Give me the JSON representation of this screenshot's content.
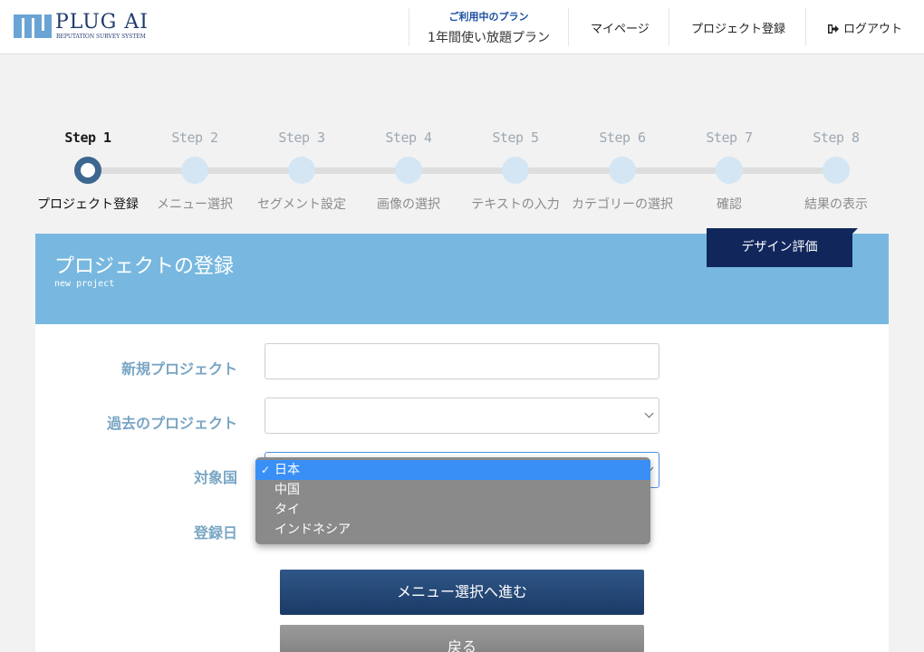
{
  "header": {
    "logo_title": "PLUG AI",
    "logo_subtitle": "REPUTATION SURVEY SYSTEM",
    "plan_label": "ご利用中のプラン",
    "plan_name": "1年間使い放題プラン",
    "nav": {
      "mypage": "マイページ",
      "project_register": "プロジェクト登録",
      "logout": "ログアウト"
    }
  },
  "steps": [
    {
      "title": "Step 1",
      "label": "プロジェクト登録",
      "active": true
    },
    {
      "title": "Step 2",
      "label": "メニュー選択",
      "active": false
    },
    {
      "title": "Step 3",
      "label": "セグメント設定",
      "active": false
    },
    {
      "title": "Step 4",
      "label": "画像の選択",
      "active": false
    },
    {
      "title": "Step 5",
      "label": "テキストの入力",
      "active": false
    },
    {
      "title": "Step 6",
      "label": "カテゴリーの選択",
      "active": false
    },
    {
      "title": "Step 7",
      "label": "確認",
      "active": false
    },
    {
      "title": "Step 8",
      "label": "結果の表示",
      "active": false
    }
  ],
  "panel": {
    "title": "プロジェクトの登録",
    "subtitle": "new project",
    "tab_label": "デザイン評価"
  },
  "form": {
    "new_project_label": "新規プロジェクト",
    "new_project_value": "",
    "past_project_label": "過去のプロジェクト",
    "past_project_value": "",
    "country_label": "対象国",
    "country_value": "日本",
    "country_options": [
      "日本",
      "中国",
      "タイ",
      "インドネシア"
    ],
    "date_label": "登録日"
  },
  "buttons": {
    "next": "メニュー選択へ進む",
    "back": "戻る"
  },
  "colors": {
    "brand_navy": "#11275c",
    "panel_blue": "#78b8e0",
    "label_blue": "#79a6c4",
    "step_active": "#3d6690",
    "selected_option": "#3a8ff7"
  }
}
